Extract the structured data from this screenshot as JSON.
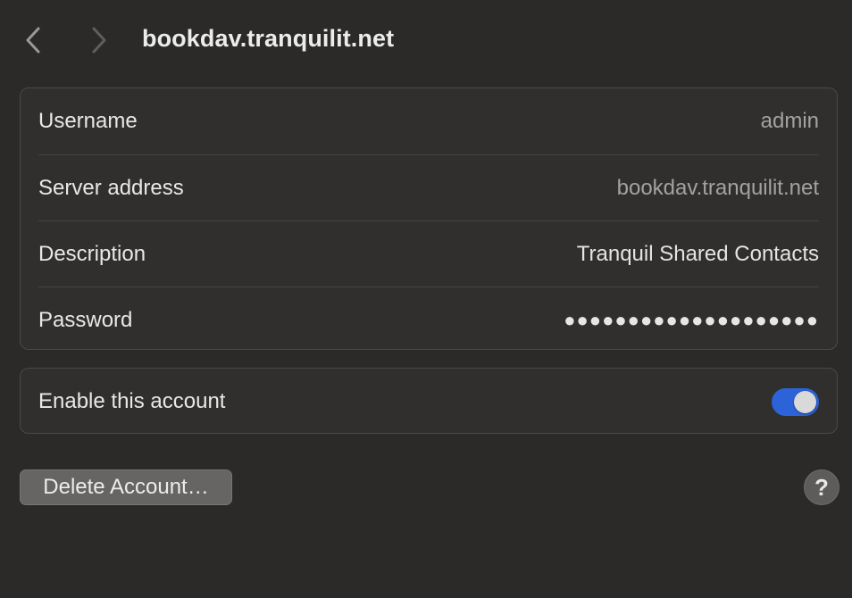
{
  "header": {
    "title": "bookdav.tranquilit.net",
    "back_icon": "chevron-left-icon",
    "forward_icon": "chevron-right-icon"
  },
  "details": {
    "rows": [
      {
        "label": "Username",
        "value": "admin"
      },
      {
        "label": "Server address",
        "value": "bookdav.tranquilit.net"
      },
      {
        "label": "Description",
        "value": "Tranquil Shared Contacts"
      },
      {
        "label": "Password",
        "value": "●●●●●●●●●●●●●●●●●●●●"
      }
    ]
  },
  "enable": {
    "label": "Enable this account",
    "enabled": true
  },
  "actions": {
    "delete_label": "Delete Account…",
    "help_label": "?"
  },
  "colors": {
    "background": "#2b2a29",
    "toggle_on": "#2d63d8"
  }
}
